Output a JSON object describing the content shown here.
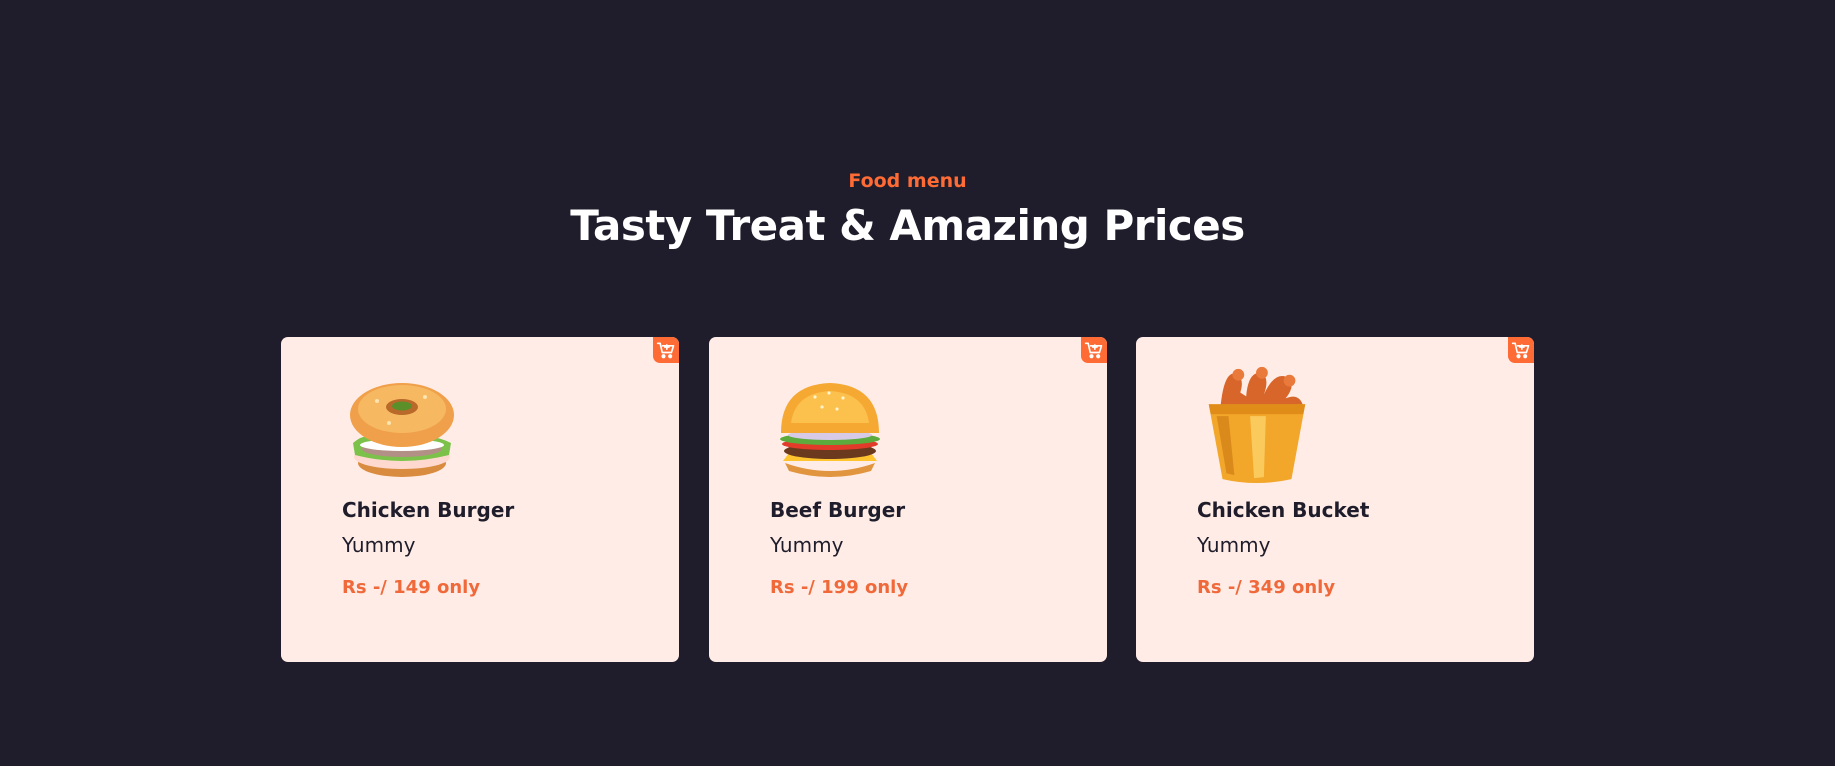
{
  "section": {
    "eyebrow": "Food menu",
    "title": "Tasty Treat & Amazing Prices"
  },
  "accent_color": "#ff6b35",
  "background_color": "#1f1d2b",
  "card_color": "#ffece6",
  "items": [
    {
      "name": "Chicken Burger",
      "description": "Yummy",
      "price": "Rs -/ 149 only",
      "image": "bagel-burger-image",
      "cart_icon": "add-to-cart-icon"
    },
    {
      "name": "Beef Burger",
      "description": "Yummy",
      "price": "Rs -/ 199 only",
      "image": "beef-burger-image",
      "cart_icon": "add-to-cart-icon"
    },
    {
      "name": "Chicken Bucket",
      "description": "Yummy",
      "price": "Rs -/ 349 only",
      "image": "chicken-bucket-image",
      "cart_icon": "add-to-cart-icon"
    }
  ]
}
